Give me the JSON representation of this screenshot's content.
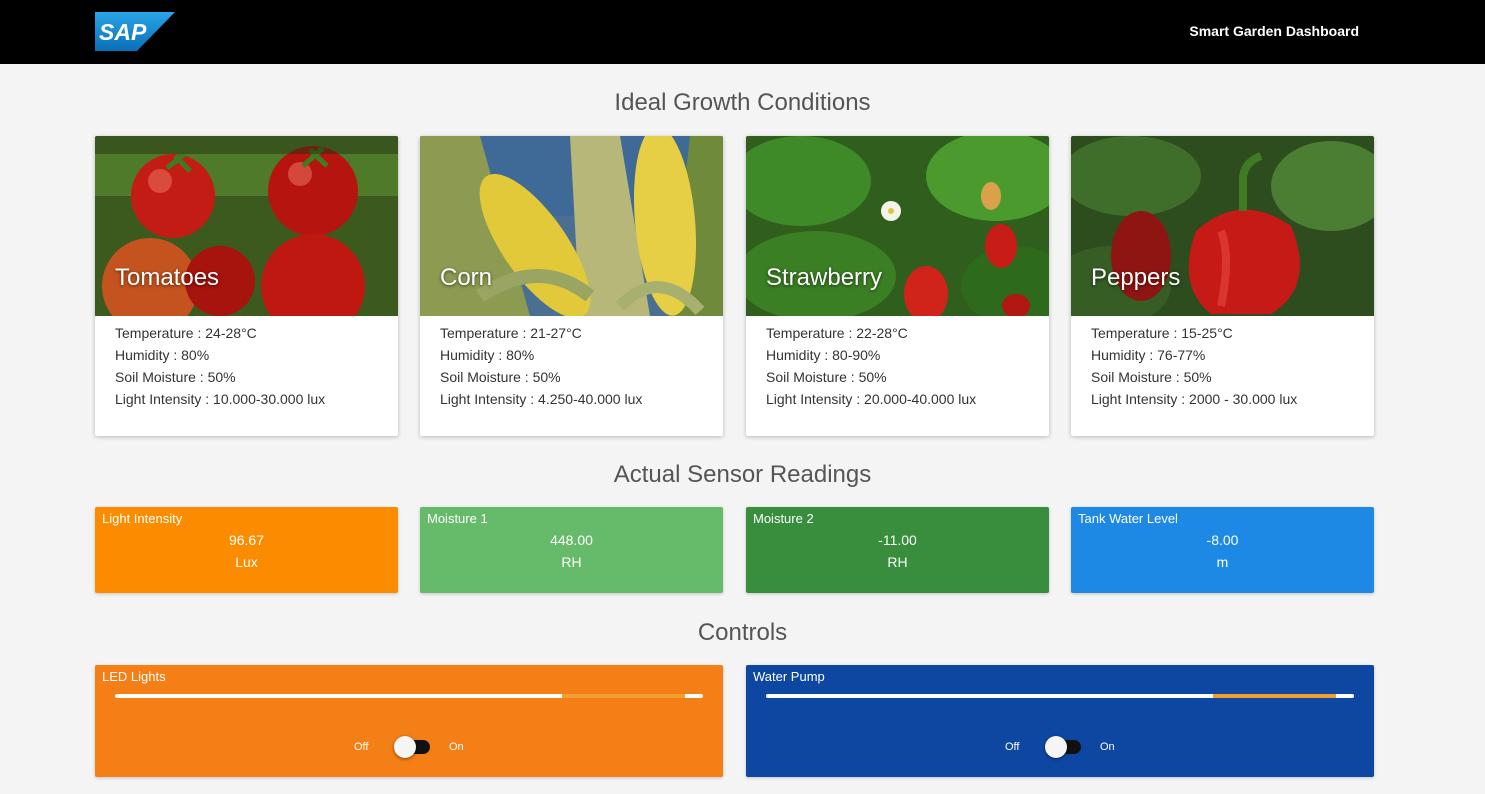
{
  "header": {
    "logo_text": "SAP",
    "title": "Smart Garden Dashboard"
  },
  "sections": {
    "ideal": "Ideal Growth Conditions",
    "sensors": "Actual Sensor Readings",
    "controls": "Controls"
  },
  "plants": [
    {
      "name": "Tomatoes",
      "temperature": "Temperature : 24-28°C",
      "humidity": "Humidity : 80%",
      "soil": "Soil Moisture : 50%",
      "light": "Light Intensity : 10.000-30.000 lux"
    },
    {
      "name": "Corn",
      "temperature": "Temperature : 21-27°C",
      "humidity": "Humidity : 80%",
      "soil": "Soil Moisture : 50%",
      "light": "Light Intensity : 4.250-40.000 lux"
    },
    {
      "name": "Strawberry",
      "temperature": "Temperature : 22-28°C",
      "humidity": "Humidity : 80-90%",
      "soil": "Soil Moisture : 50%",
      "light": "Light Intensity : 20.000-40.000 lux"
    },
    {
      "name": "Peppers",
      "temperature": "Temperature : 15-25°C",
      "humidity": "Humidity : 76-77%",
      "soil": "Soil Moisture : 50%",
      "light": "Light Intensity : 2000 - 30.000 lux"
    }
  ],
  "sensors": [
    {
      "label": "Light Intensity",
      "value": "96.67",
      "unit": "Lux",
      "color": "#fb8c00"
    },
    {
      "label": "Moisture 1",
      "value": "448.00",
      "unit": "RH",
      "color": "#66bb6a"
    },
    {
      "label": "Moisture 2",
      "value": "-11.00",
      "unit": "RH",
      "color": "#388e3c"
    },
    {
      "label": "Tank Water Level",
      "value": "-8.00",
      "unit": "m",
      "color": "#1e88e5"
    }
  ],
  "controls": [
    {
      "label": "LED Lights",
      "off_label": "Off",
      "on_label": "On",
      "color": "#f57f17",
      "slider_start": 0.76,
      "slider_end": 0.97,
      "toggle_on": false
    },
    {
      "label": "Water Pump",
      "off_label": "Off",
      "on_label": "On",
      "color": "#0d47a1",
      "slider_start": 0.76,
      "slider_end": 0.97,
      "toggle_on": false
    }
  ],
  "icons": {
    "logo": "sap-logo"
  }
}
